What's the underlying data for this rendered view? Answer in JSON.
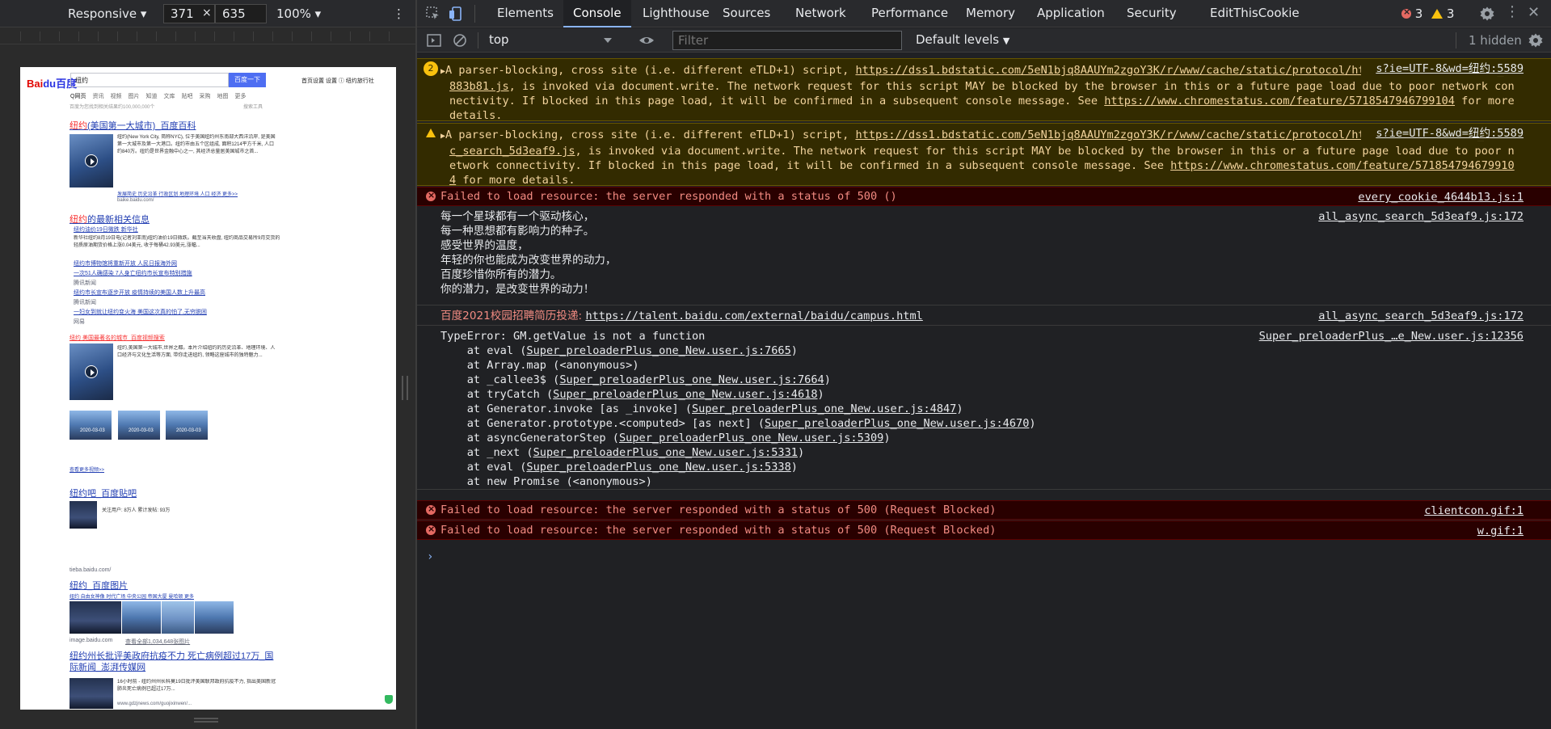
{
  "device_toolbar": {
    "device": "Responsive",
    "width": "371",
    "height": "635",
    "times": "×",
    "zoom": "100%"
  },
  "baidu": {
    "logo": "Bai",
    "logo_b": "du百度",
    "query": "纽约",
    "search_button": "百度一下",
    "right_links": "首页设置  设置  ⓘ 纽约旅行社",
    "tabs": [
      "Q网页",
      "资讯",
      "视频",
      "图片",
      "知道",
      "文库",
      "贴吧",
      "采购",
      "地图",
      "更多"
    ],
    "result_count": "百度为您找到相关结果约100,000,000个",
    "tool_link": "搜索工具",
    "r1_title_pre": "纽约",
    "r1_title": "(美国第一大城市)_百度百科",
    "r1_text": "纽约(New York City, 简称NYC), 位于美国纽约州东南部大西洋沿岸, 是美国第一大城市及第一大港口。纽约市由五个区组成, 面积1214平方千米, 人口约840万。纽约是世界金融中心之一, 其经济总量居美国城市之首...",
    "r1_links": "发展简史  历史沿革  行政区划  地理环境  人口  经济  更多>>",
    "r1_url": "baike.baidu.com/",
    "r2_title_pre": "纽约",
    "r2_title": "的最新相关信息",
    "r2_items": [
      "纽约油价19日微跌  新华社",
      "新华社纽约8月19日电(记者刘亚南)纽约油价19日微跌。截至当天收盘, 纽约商品交易所9月交货的轻质原油期货价格上涨0.04美元, 收于每桶42.93美元,涨幅...",
      "纽约市博物馆将重新开放  人民日报海外网",
      "一次51人确感染 7人身亡纽约市长宣布特别措施",
      "腾讯新闻",
      "纽约市长宣布逐步开放 疫情持续的美国人数上升最高",
      "腾讯新闻",
      "一妇女到就让纽约变火海 美国这次真的怕了,无穷脱困",
      "网易"
    ],
    "r3_title": "纽约 美国最著名的城市_百度视频搜索",
    "r3_text": "纽约,美国第一大城市,世界之都。本片介绍纽约的历史沿革、地理环境、人口经济与文化生活等方面, 带你走进纽约, 领略这座城市的独特魅力...",
    "r3_dates": [
      "2020-03-03",
      "2020-03-03",
      "2020-03-03"
    ],
    "r3_more": "查看更多视频>>",
    "r4_title": "纽约吧_百度贴吧",
    "r4_stats": "关注用户: 8万人  累计发帖: 93万",
    "r4_url": "tieba.baidu.com/",
    "r5_title": "纽约_百度图片",
    "r5_tabs": "纽约  自由女神像  时代广场  中央公园  帝国大厦  曼哈顿  更多",
    "r5_url": "image.baidu.com",
    "r5_count": "查看全部1,034,648张图片",
    "r6_title": "纽约州长批评美政府抗疫不力 死亡病例超过17万_国际新闻_澎湃传媒网",
    "r6_text": "16小时前 - 纽约州州长科莫19日批评美国联邦政府抗疫不力, 指出美国新冠肺炎死亡病例已超过17万...",
    "r6_url": "www.gdzjnews.com/guojixinwen/..."
  },
  "devtools": {
    "tabs": [
      "Elements",
      "Console",
      "Lighthouse",
      "Sources",
      "Network",
      "Performance",
      "Memory",
      "Application",
      "Security",
      "EditThisCookie"
    ],
    "active_tab": "Console",
    "error_count": "3",
    "warning_count": "3",
    "context": "top",
    "filter_placeholder": "Filter",
    "levels": "Default levels",
    "hidden": "1 hidden"
  },
  "console": {
    "m1_count": "2",
    "m1_pre": "A parser-blocking, cross site (i.e. different eTLD+1) script, ",
    "m1_url": "https://dss1.bdstatic.com/5eN1bjq8AAUYm2zgoY3K/r/www/cache/static/protocol/https/bundles/polyfill_1883b81.js",
    "m1_mid": ", is invoked via document.write. The network request for this script MAY be blocked by the browser in this or a future page load due to poor network connectivity. If blocked in this page load, it will be confirmed in a subsequent console message. See ",
    "m1_link": "https://www.chromestatus.com/feature/5718547946799104",
    "m1_post": " for more details.",
    "m1_src": "s?ie=UTF-8&wd=纽约:5589",
    "m2_pre": "A parser-blocking, cross site (i.e. different eTLD+1) script, ",
    "m2_url": "https://dss1.bdstatic.com/5eN1bjq8AAUYm2zgoY3K/r/www/cache/static/protocol/https/global/js/all_async_search_5d3eaf9.js",
    "m2_mid": ", is invoked via document.write. The network request for this script MAY be blocked by the browser in this or a future page load due to poor network connectivity. If blocked in this page load, it will be confirmed in a subsequent console message. See ",
    "m2_link": "https://www.chromestatus.com/feature/5718547946799104",
    "m2_post": " for more details.",
    "m2_src": "s?ie=UTF-8&wd=纽约:5589",
    "m3_text": "Failed to load resource: the server responded with a status of 500 ()",
    "m3_src": "every_cookie_4644b13.js:1",
    "m4_lines": [
      "每一个星球都有一个驱动核心，",
      "每一种思想都有影响力的种子。",
      "感受世界的温度，",
      "年轻的你也能成为改变世界的动力，",
      "百度珍惜你所有的潜力。",
      "你的潜力，是改变世界的动力！"
    ],
    "m4_src": "all_async_search_5d3eaf9.js:172",
    "m5_label": "百度2021校园招聘简历投递: ",
    "m5_link": "https://talent.baidu.com/external/baidu/campus.html",
    "m5_src": "all_async_search_5d3eaf9.js:172",
    "m6_head": "TypeError: GM.getValue is not a function",
    "m6_src": "Super_preloaderPlus_…e_New.user.js:12356",
    "m6_stack": [
      {
        "pre": "    at eval (",
        "link": "Super_preloaderPlus_one_New.user.js:7665",
        "post": ")"
      },
      {
        "pre": "    at Array.map (<anonymous>)",
        "link": "",
        "post": ""
      },
      {
        "pre": "    at _callee3$ (",
        "link": "Super_preloaderPlus_one_New.user.js:7664",
        "post": ")"
      },
      {
        "pre": "    at tryCatch (",
        "link": "Super_preloaderPlus_one_New.user.js:4618",
        "post": ")"
      },
      {
        "pre": "    at Generator.invoke [as _invoke] (",
        "link": "Super_preloaderPlus_one_New.user.js:4847",
        "post": ")"
      },
      {
        "pre": "    at Generator.prototype.<computed> [as next] (",
        "link": "Super_preloaderPlus_one_New.user.js:4670",
        "post": ")"
      },
      {
        "pre": "    at asyncGeneratorStep (",
        "link": "Super_preloaderPlus_one_New.user.js:5309",
        "post": ")"
      },
      {
        "pre": "    at _next (",
        "link": "Super_preloaderPlus_one_New.user.js:5331",
        "post": ")"
      },
      {
        "pre": "    at eval (",
        "link": "Super_preloaderPlus_one_New.user.js:5338",
        "post": ")"
      },
      {
        "pre": "    at new Promise (<anonymous>)",
        "link": "",
        "post": ""
      }
    ],
    "m7_text": "Failed to load resource: the server responded with a status of 500 (Request Blocked)",
    "m7_src": "clientcon.gif:1",
    "m8_text": "Failed to load resource: the server responded with a status of 500 (Request Blocked)",
    "m8_src": "w.gif:1",
    "prompt": "›"
  },
  "colors": {
    "accent": "#8ab4f8",
    "error": "#f28b82",
    "warning": "#f9c10e",
    "baidu_blue": "#4e6ef2"
  }
}
